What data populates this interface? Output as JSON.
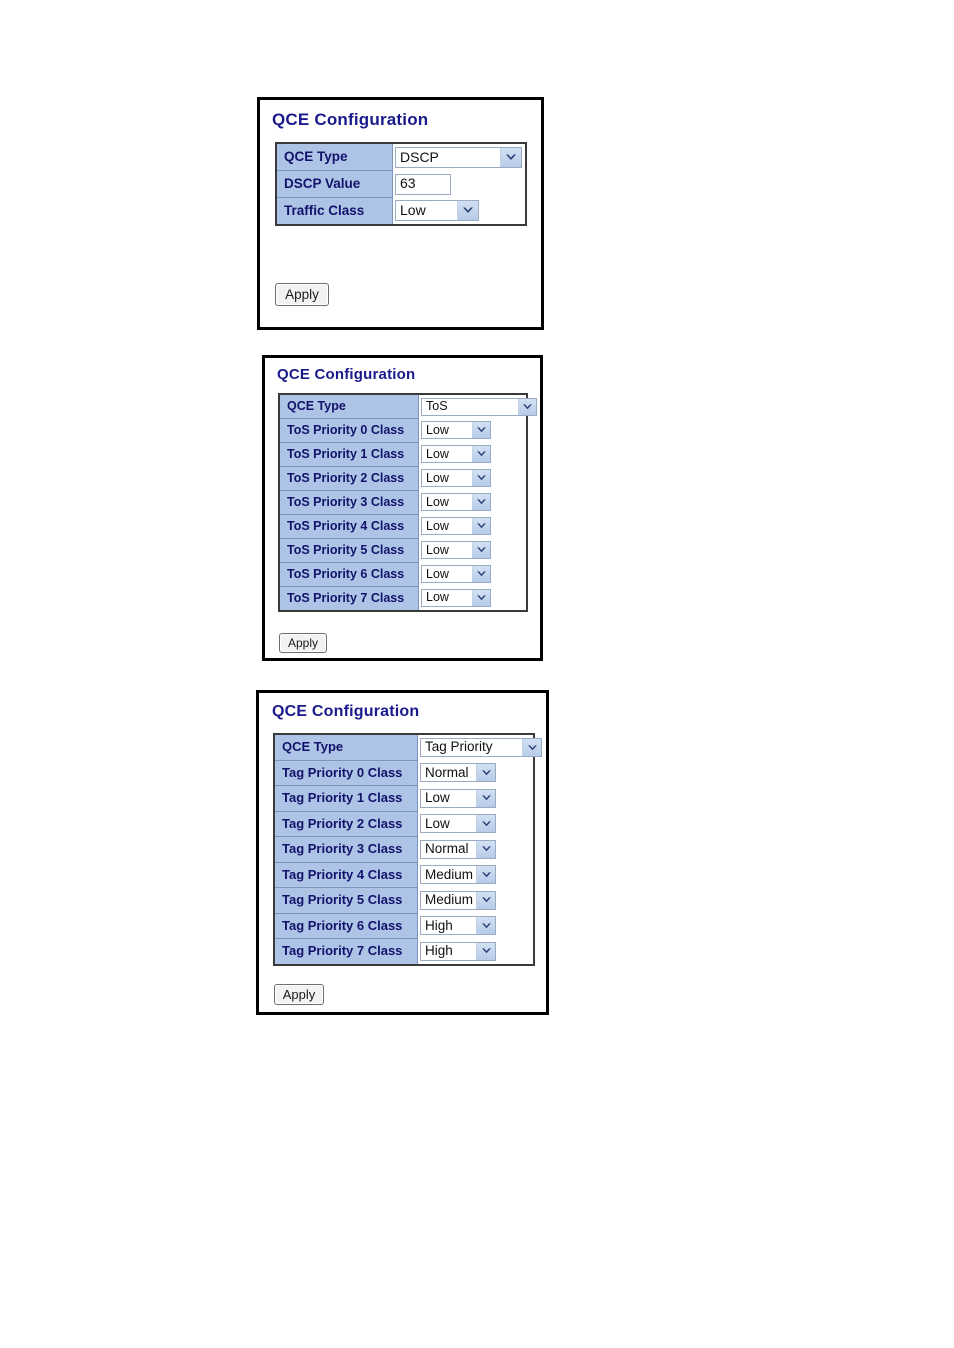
{
  "panels": [
    {
      "id": "dscp",
      "title": "QCE Configuration",
      "rows": [
        {
          "label": "QCE Type",
          "control": "select",
          "size": "wide",
          "value": "DSCP"
        },
        {
          "label": "DSCP Value",
          "control": "text",
          "size": "text",
          "value": "63"
        },
        {
          "label": "Traffic Class",
          "control": "select",
          "size": "small",
          "value": "Low"
        }
      ],
      "apply_label": "Apply"
    },
    {
      "id": "tos",
      "title": "QCE Configuration",
      "rows": [
        {
          "label": "QCE Type",
          "control": "select",
          "size": "wide",
          "value": "ToS"
        },
        {
          "label": "ToS Priority 0 Class",
          "control": "select",
          "size": "small",
          "value": "Low"
        },
        {
          "label": "ToS Priority 1 Class",
          "control": "select",
          "size": "small",
          "value": "Low"
        },
        {
          "label": "ToS Priority 2 Class",
          "control": "select",
          "size": "small",
          "value": "Low"
        },
        {
          "label": "ToS Priority 3 Class",
          "control": "select",
          "size": "small",
          "value": "Low"
        },
        {
          "label": "ToS Priority 4 Class",
          "control": "select",
          "size": "small",
          "value": "Low"
        },
        {
          "label": "ToS Priority 5 Class",
          "control": "select",
          "size": "small",
          "value": "Low"
        },
        {
          "label": "ToS Priority 6 Class",
          "control": "select",
          "size": "small",
          "value": "Low"
        },
        {
          "label": "ToS Priority 7 Class",
          "control": "select",
          "size": "small",
          "value": "Low"
        }
      ],
      "apply_label": "Apply"
    },
    {
      "id": "tag",
      "title": "QCE Configuration",
      "rows": [
        {
          "label": "QCE Type",
          "control": "select",
          "size": "wide",
          "value": "Tag Priority"
        },
        {
          "label": "Tag Priority 0 Class",
          "control": "select",
          "size": "small",
          "value": "Normal"
        },
        {
          "label": "Tag Priority 1 Class",
          "control": "select",
          "size": "small",
          "value": "Low"
        },
        {
          "label": "Tag Priority 2 Class",
          "control": "select",
          "size": "small",
          "value": "Low"
        },
        {
          "label": "Tag Priority 3 Class",
          "control": "select",
          "size": "small",
          "value": "Normal"
        },
        {
          "label": "Tag Priority 4 Class",
          "control": "select",
          "size": "small",
          "value": "Medium"
        },
        {
          "label": "Tag Priority 5 Class",
          "control": "select",
          "size": "small",
          "value": "Medium"
        },
        {
          "label": "Tag Priority 6 Class",
          "control": "select",
          "size": "small",
          "value": "High"
        },
        {
          "label": "Tag Priority 7 Class",
          "control": "select",
          "size": "small",
          "value": "High"
        }
      ],
      "apply_label": "Apply"
    }
  ],
  "icons": {
    "dropdown": "chevron-down-icon"
  },
  "colors": {
    "title_text": "#1a1a8c",
    "label_bg": "#aec4e6",
    "label_text": "#12126b",
    "panel_border": "#000000",
    "table_border": "#3a3a3a",
    "control_border": "#9aacc4",
    "arrow_bg": "#b7cbe9"
  }
}
